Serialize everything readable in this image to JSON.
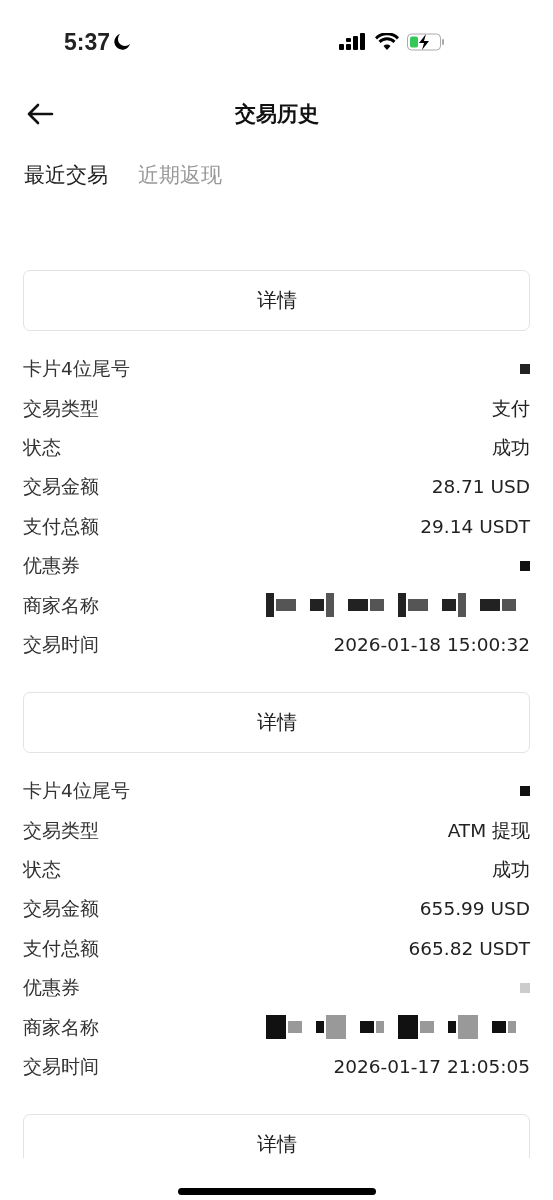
{
  "status_bar": {
    "time": "5:37"
  },
  "header": {
    "title": "交易历史"
  },
  "tabs": [
    {
      "label": "最近交易",
      "selected": true
    },
    {
      "label": "近期返现",
      "selected": false
    }
  ],
  "transactions": [
    {
      "button": "详情",
      "fields": [
        {
          "kind": "redacted",
          "label": "卡片4位尾号"
        },
        {
          "kind": "text",
          "label": "交易类型",
          "value": "支付"
        },
        {
          "kind": "text",
          "label": "状态",
          "value": "成功"
        },
        {
          "kind": "text",
          "label": "交易金额",
          "value": "28.71 USD"
        },
        {
          "kind": "text",
          "label": "支付总额",
          "value": "29.14 USDT"
        },
        {
          "kind": "redacted",
          "label": "优惠券"
        },
        {
          "kind": "redacted",
          "label": "商家名称"
        },
        {
          "kind": "text",
          "label": "交易时间",
          "value": "2026-01-18 15:00:32"
        }
      ]
    },
    {
      "button": "详情",
      "fields": [
        {
          "kind": "redacted",
          "label": "卡片4位尾号"
        },
        {
          "kind": "text",
          "label": "交易类型",
          "value": "ATM 提现"
        },
        {
          "kind": "text",
          "label": "状态",
          "value": "成功"
        },
        {
          "kind": "text",
          "label": "交易金额",
          "value": "655.99 USD"
        },
        {
          "kind": "text",
          "label": "支付总额",
          "value": "665.82 USDT"
        },
        {
          "kind": "redacted",
          "label": "优惠券"
        },
        {
          "kind": "redacted",
          "label": "商家名称"
        },
        {
          "kind": "text",
          "label": "交易时间",
          "value": "2026-01-17 21:05:05"
        }
      ]
    },
    {
      "button": "详情"
    }
  ]
}
